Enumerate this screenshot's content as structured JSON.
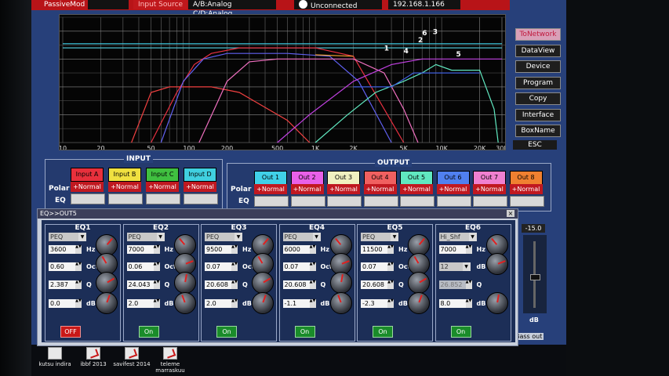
{
  "topbar": {
    "item1": "PassiveMod",
    "item2": "Input Source",
    "item3": "A/B:Analog  C/D:Analog",
    "connection": "Unconnected",
    "ip": "192.168.1.166"
  },
  "graph": {
    "x_ticks": [
      "10",
      "20",
      "50",
      "100",
      "200",
      "500",
      "1K",
      "2K",
      "5K",
      "10K",
      "20K",
      "30K"
    ],
    "y_ticks": [
      "0",
      "-10",
      "-20",
      "-30",
      "-40"
    ],
    "markers": [
      "1",
      "2",
      "3",
      "4",
      "5",
      "6"
    ]
  },
  "sidebar": {
    "items": [
      "ToNetwork",
      "DataView",
      "Device",
      "Program",
      "Copy",
      "Interface",
      "BoxName"
    ],
    "esc": "ESC"
  },
  "input": {
    "title": "INPUT",
    "polar_label": "Polar",
    "eq_label": "EQ",
    "channels": [
      {
        "label": "Input A",
        "color": "#e8303c",
        "polar": "+Normal"
      },
      {
        "label": "Input B",
        "color": "#f0e040",
        "polar": "+Normal"
      },
      {
        "label": "Input C",
        "color": "#40c040",
        "polar": "+Normal"
      },
      {
        "label": "Input D",
        "color": "#40d0e0",
        "polar": "+Normal"
      }
    ]
  },
  "output": {
    "title": "OUTPUT",
    "polar_label": "Polar",
    "eq_label": "EQ",
    "channels": [
      {
        "label": "Out 1",
        "color": "#40d0e8",
        "polar": "+Normal"
      },
      {
        "label": "Out 2",
        "color": "#e860e8",
        "polar": "+Normal"
      },
      {
        "label": "Out 3",
        "color": "#f0f0c0",
        "polar": "+Normal"
      },
      {
        "label": "Out 4",
        "color": "#f06060",
        "polar": "+Normal"
      },
      {
        "label": "Out 5",
        "color": "#60e8c0",
        "polar": "+Normal"
      },
      {
        "label": "Out 6",
        "color": "#5080f0",
        "polar": "+Normal"
      },
      {
        "label": "Out 7",
        "color": "#f080d0",
        "polar": "+Normal"
      },
      {
        "label": "Out 8",
        "color": "#f08030",
        "polar": "+Normal"
      }
    ]
  },
  "dialog": {
    "title": "EQ>>OUT5",
    "close": "×",
    "bands": [
      {
        "name": "EQ1",
        "type": "PEQ",
        "freq": "3600",
        "oct": "0.60",
        "q": "2.387",
        "db": "0.0",
        "state": "OFF",
        "u1": "Hz",
        "u2": "Oct",
        "u3": "Q",
        "u4": "dB"
      },
      {
        "name": "EQ2",
        "type": "PEQ",
        "freq": "7000",
        "oct": "0.06",
        "q": "24.043",
        "db": "2.0",
        "state": "On",
        "u1": "Hz",
        "u2": "Oct",
        "u3": "Q",
        "u4": "dB"
      },
      {
        "name": "EQ3",
        "type": "PEQ",
        "freq": "9500",
        "oct": "0.07",
        "q": "20.608",
        "db": "2.0",
        "state": "On",
        "u1": "Hz",
        "u2": "Oct",
        "u3": "Q",
        "u4": "dB"
      },
      {
        "name": "EQ4",
        "type": "PEQ",
        "freq": "6000",
        "oct": "0.07",
        "q": "20.608",
        "db": "-1.1",
        "state": "On",
        "u1": "Hz",
        "u2": "Oct",
        "u3": "Q",
        "u4": "dB"
      },
      {
        "name": "EQ5",
        "type": "PEQ",
        "freq": "11500",
        "oct": "0.07",
        "q": "20.608",
        "db": "-2.3",
        "state": "On",
        "u1": "Hz",
        "u2": "Oct",
        "u3": "Q",
        "u4": "dB"
      },
      {
        "name": "EQ6",
        "type": "Hi_Shf",
        "freq": "7000",
        "oct": "12",
        "q": "26.852",
        "db": "8.0",
        "state": "On",
        "u1": "Hz",
        "u2": "dB",
        "u3": "Q",
        "u4": "dB"
      }
    ]
  },
  "right_panel": {
    "level": "-15.0",
    "unit": "dB",
    "bass_out": "Bass out"
  },
  "desktop": {
    "icons": [
      {
        "label": "kutsu indira",
        "kind": "doc"
      },
      {
        "label": "ibbf 2013",
        "kind": "pdf"
      },
      {
        "label": "savifest 2014",
        "kind": "pdf"
      },
      {
        "label": "teleme marraskuu",
        "kind": "pdf"
      }
    ]
  },
  "colors": {
    "background": "#27407a",
    "panel": "#243a6e",
    "topbar": "#b81418",
    "on": "#1a8c2a",
    "off": "#c81818"
  }
}
